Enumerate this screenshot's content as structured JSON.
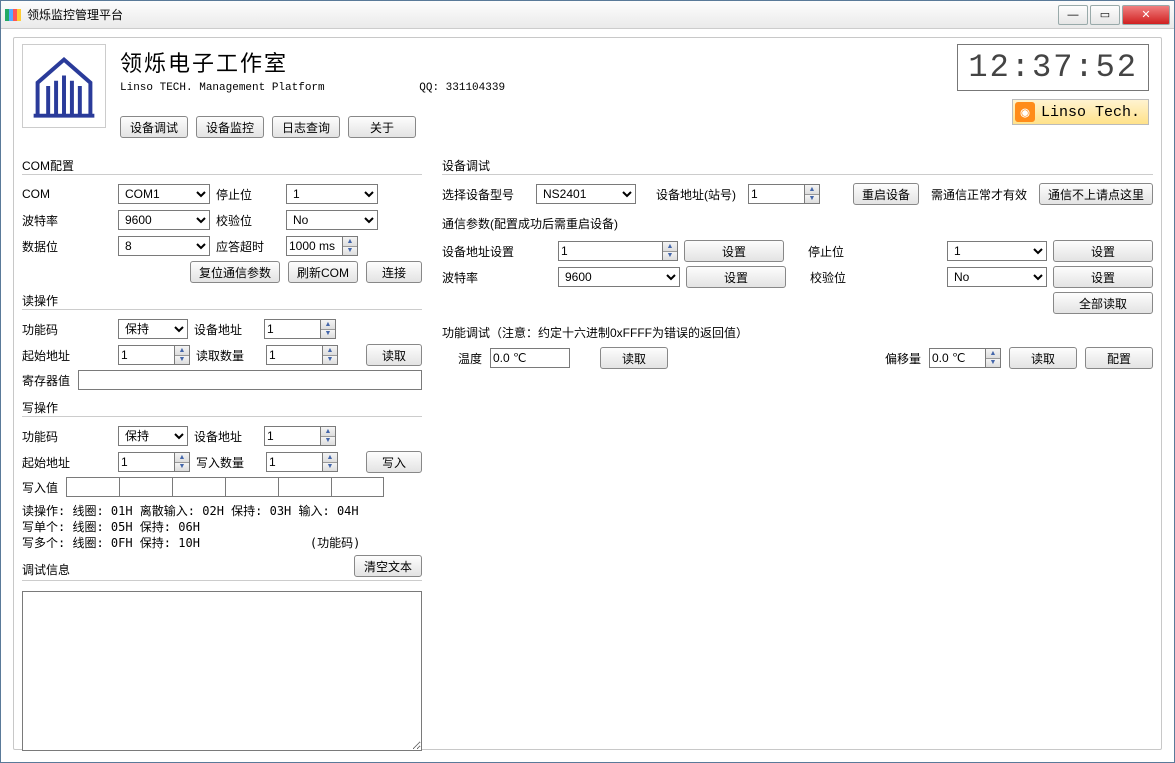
{
  "window": {
    "title": "领烁监控管理平台"
  },
  "header": {
    "brand_title": "领烁电子工作室",
    "brand_sub": "Linso TECH. Management Platform",
    "qq_label": "QQ: 331104339",
    "clock": "12:37:52",
    "linso_badge": "Linso Tech."
  },
  "toolbar": {
    "debug": "设备调试",
    "monitor": "设备监控",
    "logs": "日志查询",
    "about": "关于"
  },
  "com": {
    "group": "COM配置",
    "com_label": "COM",
    "com_value": "COM1",
    "stop_label": "停止位",
    "stop_value": "1",
    "baud_label": "波特率",
    "baud_value": "9600",
    "parity_label": "校验位",
    "parity_value": "No",
    "databits_label": "数据位",
    "databits_value": "8",
    "timeout_label": "应答超时",
    "timeout_value": "1000 ms",
    "reset_btn": "复位通信参数",
    "refresh_btn": "刷新COM",
    "connect_btn": "连接"
  },
  "read": {
    "group": "读操作",
    "func_label": "功能码",
    "func_value": "保持",
    "addr_label": "设备地址",
    "addr_value": "1",
    "start_label": "起始地址",
    "start_value": "1",
    "count_label": "读取数量",
    "count_value": "1",
    "read_btn": "读取",
    "reg_label": "寄存器值",
    "reg_value": ""
  },
  "write": {
    "group": "写操作",
    "func_label": "功能码",
    "func_value": "保持",
    "addr_label": "设备地址",
    "addr_value": "1",
    "start_label": "起始地址",
    "start_value": "1",
    "count_label": "写入数量",
    "count_value": "1",
    "write_btn": "写入",
    "val_label": "写入值"
  },
  "help": {
    "l1": "读操作: 线圈: 01H 离散输入: 02H 保持: 03H 输入: 04H",
    "l2": "写单个: 线圈: 05H 保持: 06H",
    "l3": "写多个: 线圈: 0FH 保持: 10H",
    "l3_suffix": "(功能码)"
  },
  "debug": {
    "group": "调试信息",
    "clear_btn": "清空文本"
  },
  "device": {
    "group": "设备调试",
    "model_label": "选择设备型号",
    "model_value": "NS2401",
    "addr_label": "设备地址(站号)",
    "addr_value": "1",
    "restart_btn": "重启设备",
    "note1": "需通信正常才有效",
    "note2_btn": "通信不上请点这里"
  },
  "comm": {
    "group": "通信参数(配置成功后需重启设备)",
    "addr_label": "设备地址设置",
    "addr_value": "1",
    "set_btn": "设置",
    "baud_label": "波特率",
    "baud_value": "9600",
    "stop_label": "停止位",
    "stop_value": "1",
    "parity_label": "校验位",
    "parity_value": "No",
    "read_all_btn": "全部读取"
  },
  "func": {
    "group": "功能调试（注意：约定十六进制0xFFFF为错误的返回值）",
    "temp_label": "温度",
    "temp_value": "0.0 ℃",
    "read_btn": "读取",
    "offset_label": "偏移量",
    "offset_value": "0.0 ℃",
    "config_btn": "配置"
  }
}
